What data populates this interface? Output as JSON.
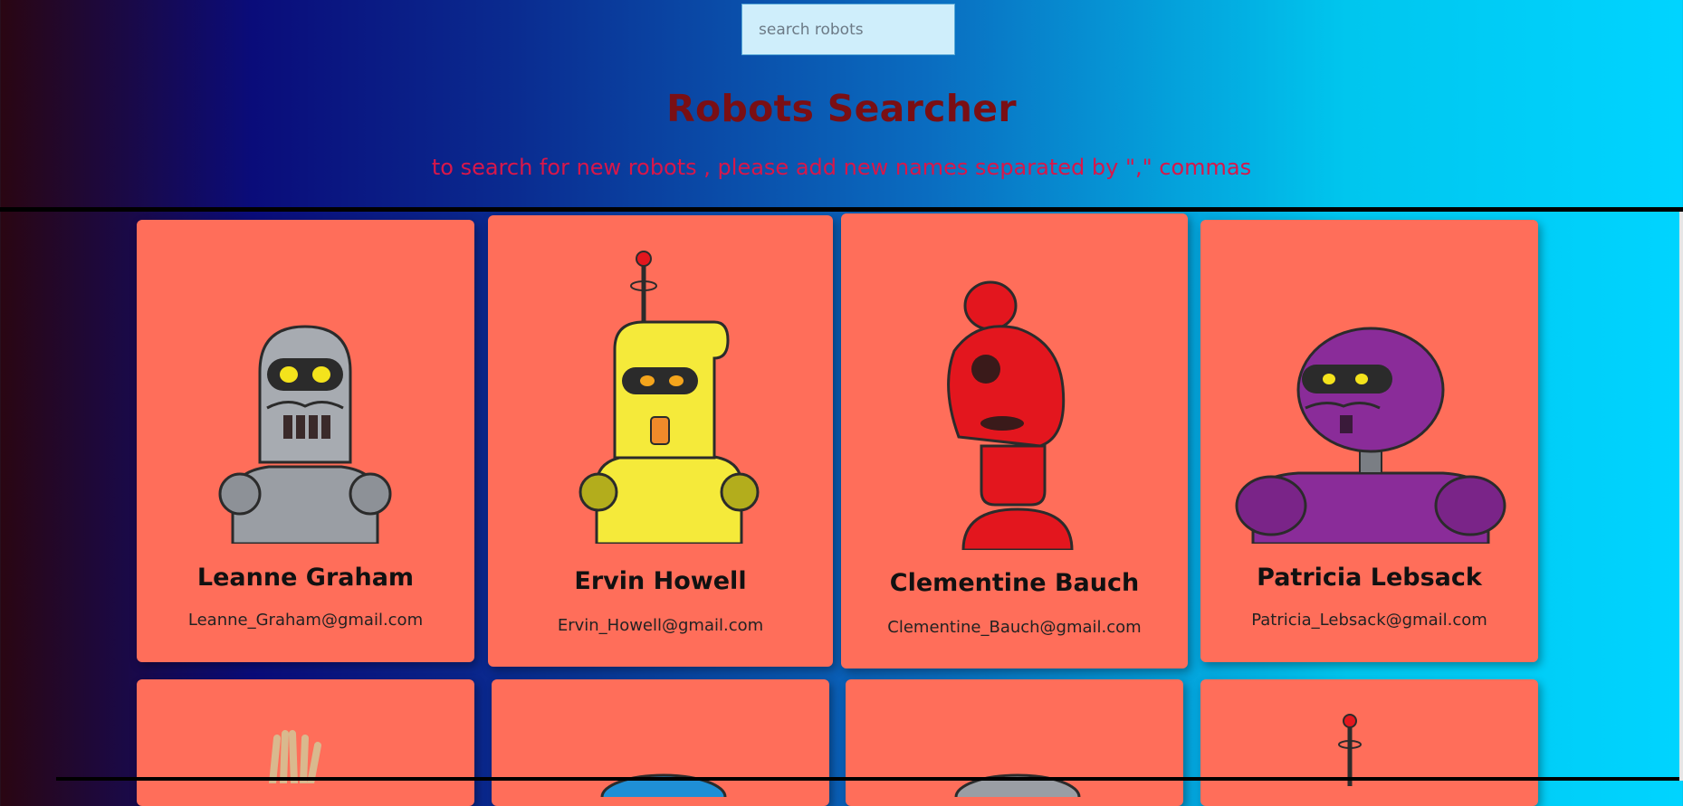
{
  "header": {
    "search_placeholder": "search robots",
    "search_value": "",
    "title": "Robots Searcher",
    "subtitle": "to search for new robots , please add new names separated by \",\" commas"
  },
  "robots": [
    {
      "name": "Leanne Graham",
      "email": "Leanne_Graham@gmail.com",
      "color": "#9a9ea4"
    },
    {
      "name": "Ervin Howell",
      "email": "Ervin_Howell@gmail.com",
      "color": "#f5ea3a"
    },
    {
      "name": "Clementine Bauch",
      "email": "Clementine_Bauch@gmail.com",
      "color": "#e3161e"
    },
    {
      "name": "Patricia Lebsack",
      "email": "Patricia_Lebsack@gmail.com",
      "color": "#8a2c99"
    }
  ],
  "colors": {
    "card_bg": "#ff6e5a",
    "title": "#7a0f14",
    "subtitle": "#d8174a"
  }
}
